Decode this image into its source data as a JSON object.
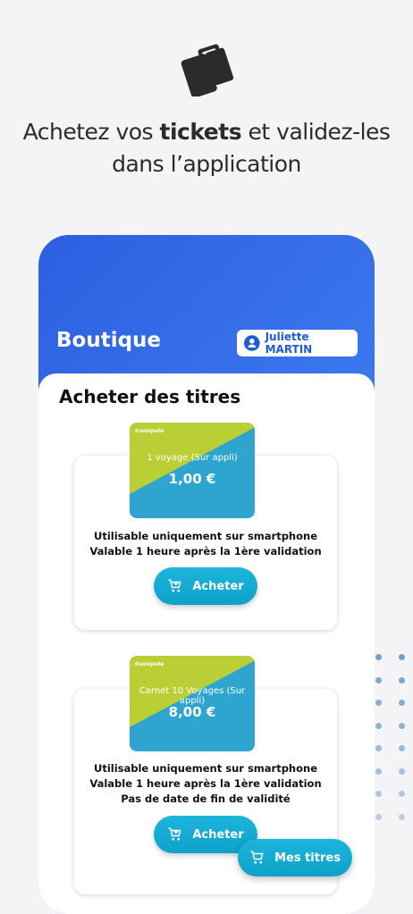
{
  "headline": {
    "part1": "Achetez vos ",
    "bold": "tickets",
    "part2": " et validez-les",
    "line2": "dans l’application"
  },
  "app": {
    "title": "Boutique",
    "user_name": "Juliette MARTIN"
  },
  "shop": {
    "section_title": "Acheter des titres"
  },
  "offers": [
    {
      "ticket_brand": "transpole",
      "ticket_name": "1 voyage (Sur appli)",
      "price": "1,00 €",
      "desc_lines": [
        "Utilisable uniquement sur smartphone",
        "Valable 1 heure après la 1ère validation"
      ],
      "button_label": "Acheter"
    },
    {
      "ticket_brand": "transpole",
      "ticket_name": "Carnet 10 Voyages (Sur appli)",
      "price": "8,00 €",
      "desc_lines": [
        "Utilisable uniquement sur smartphone",
        "Valable 1 heure après la 1ère validation",
        "Pas de date de fin de validité"
      ],
      "button_label": "Acheter"
    }
  ],
  "fab": {
    "label": "Mes titres"
  },
  "colors": {
    "primary_blue": "#2d5fe0",
    "button_cyan": "#1cb5db",
    "ticket_green": "#b9cf35",
    "ticket_blue": "#2ea5cf"
  },
  "icons": {
    "hero": "tickets-icon",
    "user": "user-circle-icon",
    "cart": "cart-plus-icon"
  }
}
